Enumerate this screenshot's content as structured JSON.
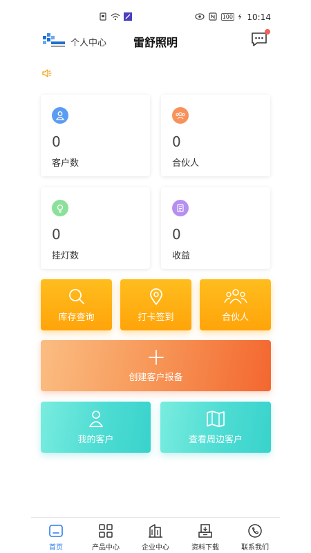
{
  "status_bar": {
    "time": "10:14",
    "battery": "100"
  },
  "header": {
    "personal_center": "个人中心",
    "title": "雷舒照明"
  },
  "stats": [
    {
      "value": "0",
      "label": "客户数",
      "icon": "customer-icon",
      "color": "#5b9cf2"
    },
    {
      "value": "0",
      "label": "合伙人",
      "icon": "partner-group-icon",
      "color": "#f8915a"
    },
    {
      "value": "0",
      "label": "挂灯数",
      "icon": "lamp-icon",
      "color": "#8be09a"
    },
    {
      "value": "0",
      "label": "收益",
      "icon": "earnings-icon",
      "color": "#b690f0"
    }
  ],
  "actions": {
    "inventory": "库存查询",
    "checkin": "打卡签到",
    "partner": "合伙人",
    "create_report": "创建客户报备",
    "my_customers": "我的客户",
    "nearby_customers": "查看周边客户"
  },
  "nav": [
    {
      "label": "首页",
      "icon": "home-icon"
    },
    {
      "label": "产品中心",
      "icon": "grid-icon"
    },
    {
      "label": "企业中心",
      "icon": "building-icon"
    },
    {
      "label": "资料下载",
      "icon": "download-icon"
    },
    {
      "label": "联系我们",
      "icon": "phone-icon"
    }
  ],
  "colors": {
    "orange": "#ffa40a",
    "active_nav": "#2b7de9",
    "teal": "#38d3cc"
  }
}
